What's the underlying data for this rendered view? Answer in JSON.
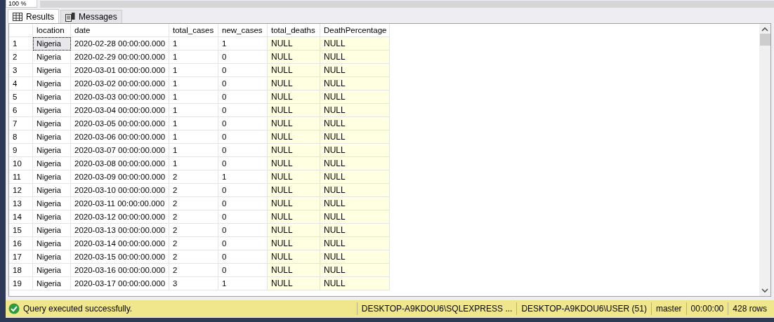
{
  "zoom": {
    "value": "100 %"
  },
  "tabs": [
    {
      "label": "Results",
      "kind": "grid",
      "selected": true
    },
    {
      "label": "Messages",
      "kind": "messages",
      "selected": false
    }
  ],
  "table": {
    "columns": [
      {
        "label": "location",
        "shaded": false
      },
      {
        "label": "date",
        "shaded": false
      },
      {
        "label": "total_cases",
        "shaded": false
      },
      {
        "label": "new_cases",
        "shaded": false
      },
      {
        "label": "total_deaths",
        "shaded": true
      },
      {
        "label": "DeathPercentage",
        "shaded": true
      }
    ],
    "rows": [
      {
        "number": "1",
        "focused": true,
        "cells": [
          "Nigeria",
          "2020-02-28 00:00:00.000",
          "1",
          "1",
          "NULL",
          "NULL"
        ]
      },
      {
        "number": "2",
        "focused": false,
        "cells": [
          "Nigeria",
          "2020-02-29 00:00:00.000",
          "1",
          "0",
          "NULL",
          "NULL"
        ]
      },
      {
        "number": "3",
        "focused": false,
        "cells": [
          "Nigeria",
          "2020-03-01 00:00:00.000",
          "1",
          "0",
          "NULL",
          "NULL"
        ]
      },
      {
        "number": "4",
        "focused": false,
        "cells": [
          "Nigeria",
          "2020-03-02 00:00:00.000",
          "1",
          "0",
          "NULL",
          "NULL"
        ]
      },
      {
        "number": "5",
        "focused": false,
        "cells": [
          "Nigeria",
          "2020-03-03 00:00:00.000",
          "1",
          "0",
          "NULL",
          "NULL"
        ]
      },
      {
        "number": "6",
        "focused": false,
        "cells": [
          "Nigeria",
          "2020-03-04 00:00:00.000",
          "1",
          "0",
          "NULL",
          "NULL"
        ]
      },
      {
        "number": "7",
        "focused": false,
        "cells": [
          "Nigeria",
          "2020-03-05 00:00:00.000",
          "1",
          "0",
          "NULL",
          "NULL"
        ]
      },
      {
        "number": "8",
        "focused": false,
        "cells": [
          "Nigeria",
          "2020-03-06 00:00:00.000",
          "1",
          "0",
          "NULL",
          "NULL"
        ]
      },
      {
        "number": "9",
        "focused": false,
        "cells": [
          "Nigeria",
          "2020-03-07 00:00:00.000",
          "1",
          "0",
          "NULL",
          "NULL"
        ]
      },
      {
        "number": "10",
        "focused": false,
        "cells": [
          "Nigeria",
          "2020-03-08 00:00:00.000",
          "1",
          "0",
          "NULL",
          "NULL"
        ]
      },
      {
        "number": "11",
        "focused": false,
        "cells": [
          "Nigeria",
          "2020-03-09 00:00:00.000",
          "2",
          "1",
          "NULL",
          "NULL"
        ]
      },
      {
        "number": "12",
        "focused": false,
        "cells": [
          "Nigeria",
          "2020-03-10 00:00:00.000",
          "2",
          "0",
          "NULL",
          "NULL"
        ]
      },
      {
        "number": "13",
        "focused": false,
        "cells": [
          "Nigeria",
          "2020-03-11 00:00:00.000",
          "2",
          "0",
          "NULL",
          "NULL"
        ]
      },
      {
        "number": "14",
        "focused": false,
        "cells": [
          "Nigeria",
          "2020-03-12 00:00:00.000",
          "2",
          "0",
          "NULL",
          "NULL"
        ]
      },
      {
        "number": "15",
        "focused": false,
        "cells": [
          "Nigeria",
          "2020-03-13 00:00:00.000",
          "2",
          "0",
          "NULL",
          "NULL"
        ]
      },
      {
        "number": "16",
        "focused": false,
        "cells": [
          "Nigeria",
          "2020-03-14 00:00:00.000",
          "2",
          "0",
          "NULL",
          "NULL"
        ]
      },
      {
        "number": "17",
        "focused": false,
        "cells": [
          "Nigeria",
          "2020-03-15 00:00:00.000",
          "2",
          "0",
          "NULL",
          "NULL"
        ]
      },
      {
        "number": "18",
        "focused": false,
        "cells": [
          "Nigeria",
          "2020-03-16 00:00:00.000",
          "2",
          "0",
          "NULL",
          "NULL"
        ]
      },
      {
        "number": "19",
        "focused": false,
        "cells": [
          "Nigeria",
          "2020-03-17 00:00:00.000",
          "3",
          "1",
          "NULL",
          "NULL"
        ]
      }
    ]
  },
  "status_bar": {
    "kind": "success",
    "message": "Query executed successfully.",
    "server": "DESKTOP-A9KDOU6\\SQLEXPRESS ...",
    "user": "DESKTOP-A9KDOU6\\USER (51)",
    "database": "master",
    "elapsed": "00:00:00",
    "row_count": "428 rows"
  }
}
